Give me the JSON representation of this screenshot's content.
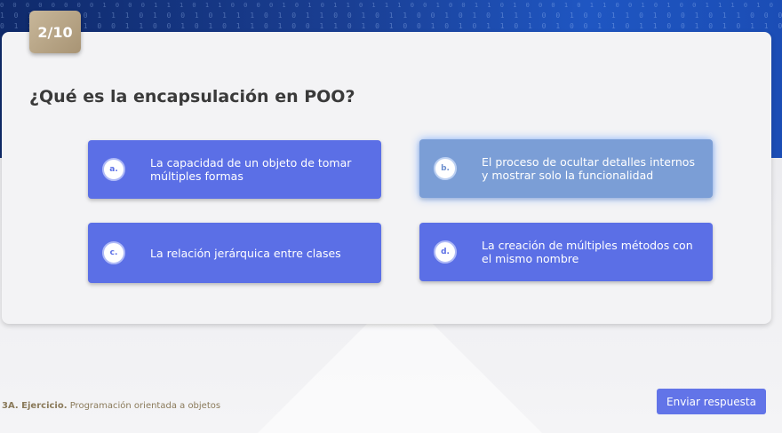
{
  "progress": {
    "counter": "2/10"
  },
  "question": {
    "text": "¿Qué es la encapsulación en POO?"
  },
  "options": [
    {
      "letter": "a.",
      "text": "La capacidad de un objeto de tomar múltiples formas",
      "selected": false
    },
    {
      "letter": "b.",
      "text": "El proceso de ocultar detalles internos y mostrar solo la funcionalidad",
      "selected": true
    },
    {
      "letter": "c.",
      "text": "La relación jerárquica entre clases",
      "selected": false
    },
    {
      "letter": "d.",
      "text": "La creación de múltiples métodos con el mismo nombre",
      "selected": false
    }
  ],
  "footer": {
    "section": "3A. Ejercicio.",
    "course": "Programación orientada a objetos"
  },
  "actions": {
    "submit_label": "Enviar respuesta"
  },
  "colors": {
    "option_bg": "#5b6fe6",
    "option_selected_bg": "#7b9ed6",
    "counter_bg": "#b8a584",
    "submit_bg": "#6274e8",
    "banner": "#1a3f94"
  }
}
